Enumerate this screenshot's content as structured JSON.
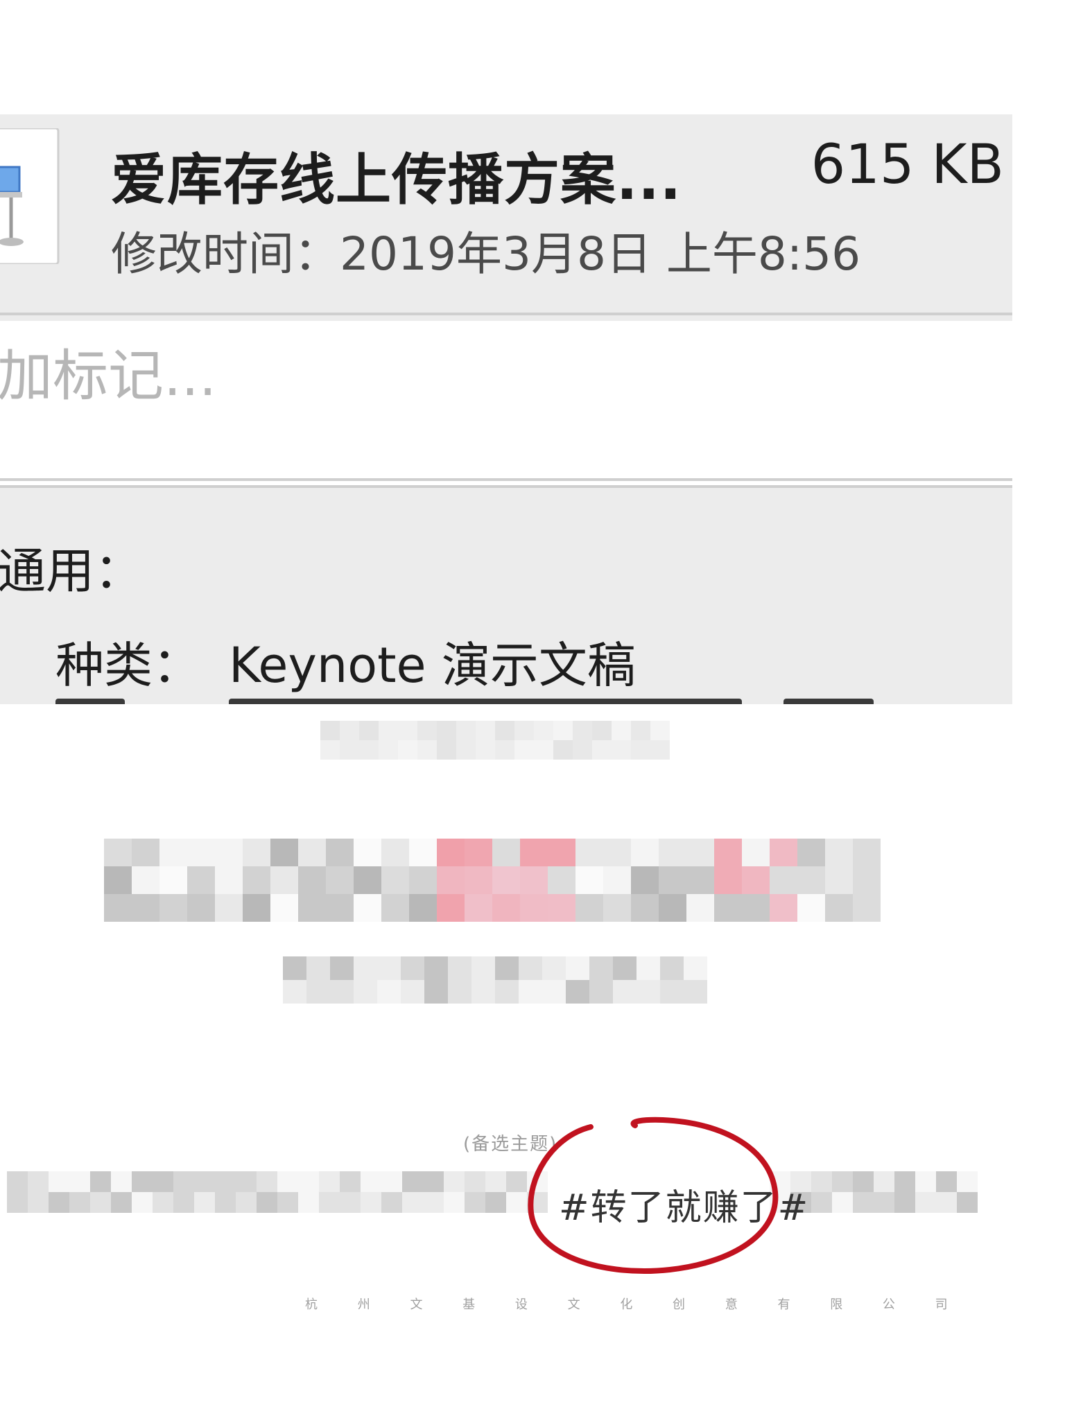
{
  "file": {
    "name": "爱库存线上传播方案...",
    "size": "615 KB",
    "modified": "修改时间：2019年3月8日 上午8:56",
    "icon": "keynote-icon"
  },
  "tags": {
    "placeholder": "加标记..."
  },
  "general": {
    "header": "通用：",
    "kind_label": "种类：",
    "kind_value": "Keynote 演示文稿"
  },
  "poster": {
    "alt_label": "(备选主题)",
    "hashtag": "#转了就赚了#",
    "footer": "杭 州 文 基 设 文 化 创 意 有 限 公 司",
    "annotation_color": "#c1121f"
  }
}
